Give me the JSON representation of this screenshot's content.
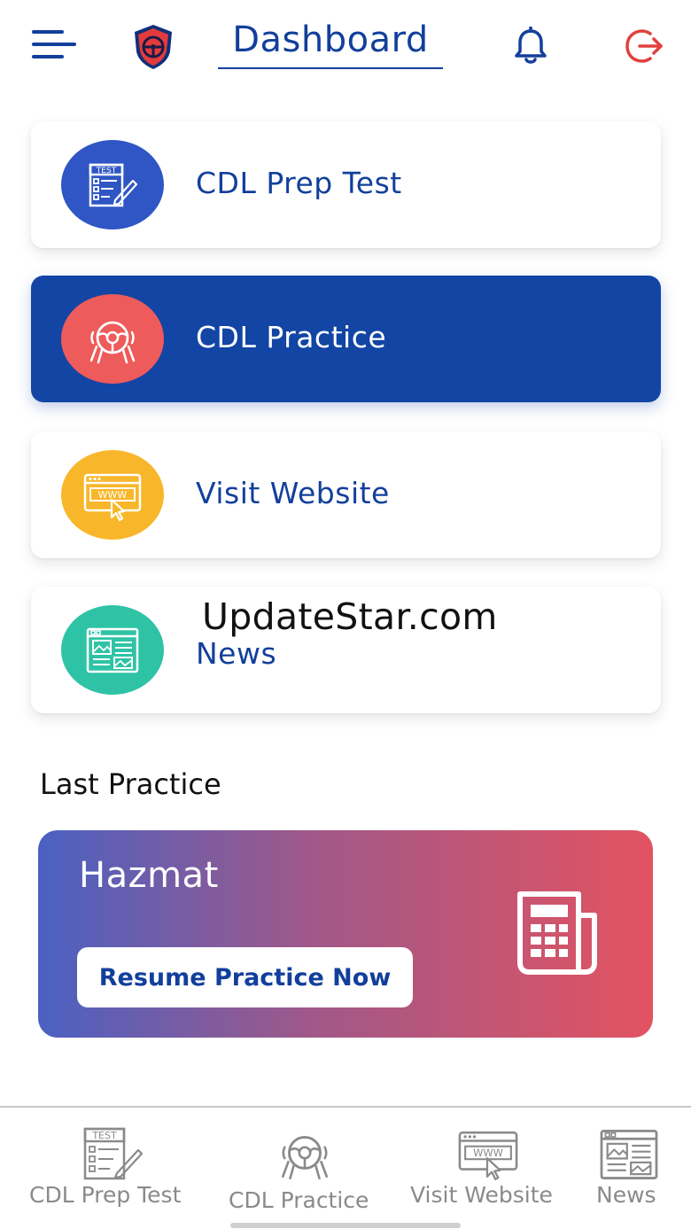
{
  "header": {
    "title": "Dashboard",
    "brand_color": "#123f9c",
    "logout_color": "#e0403c"
  },
  "menu": [
    {
      "label": "CDL Prep Test",
      "icon": "test-sheet-icon",
      "circle_color": "#2f56c4",
      "active": false
    },
    {
      "label": "CDL Practice",
      "icon": "steering-wheel-icon",
      "circle_color": "#ee5b5b",
      "active": true
    },
    {
      "label": "Visit Website",
      "icon": "www-browser-icon",
      "circle_color": "#f8b72a",
      "active": false
    },
    {
      "label": "News",
      "icon": "news-layout-icon",
      "circle_color": "#2fc3a5",
      "active": false
    }
  ],
  "watermark": "UpdateStar.com",
  "last_practice": {
    "section_title": "Last Practice",
    "name": "Hazmat",
    "button_label": "Resume Practice Now",
    "icon": "newspaper-icon"
  },
  "bottom_nav": [
    {
      "label": "CDL Prep Test",
      "icon": "test-sheet-icon"
    },
    {
      "label": "CDL Practice",
      "icon": "steering-wheel-icon"
    },
    {
      "label": "Visit Website",
      "icon": "www-browser-icon"
    },
    {
      "label": "News",
      "icon": "news-layout-icon"
    }
  ]
}
